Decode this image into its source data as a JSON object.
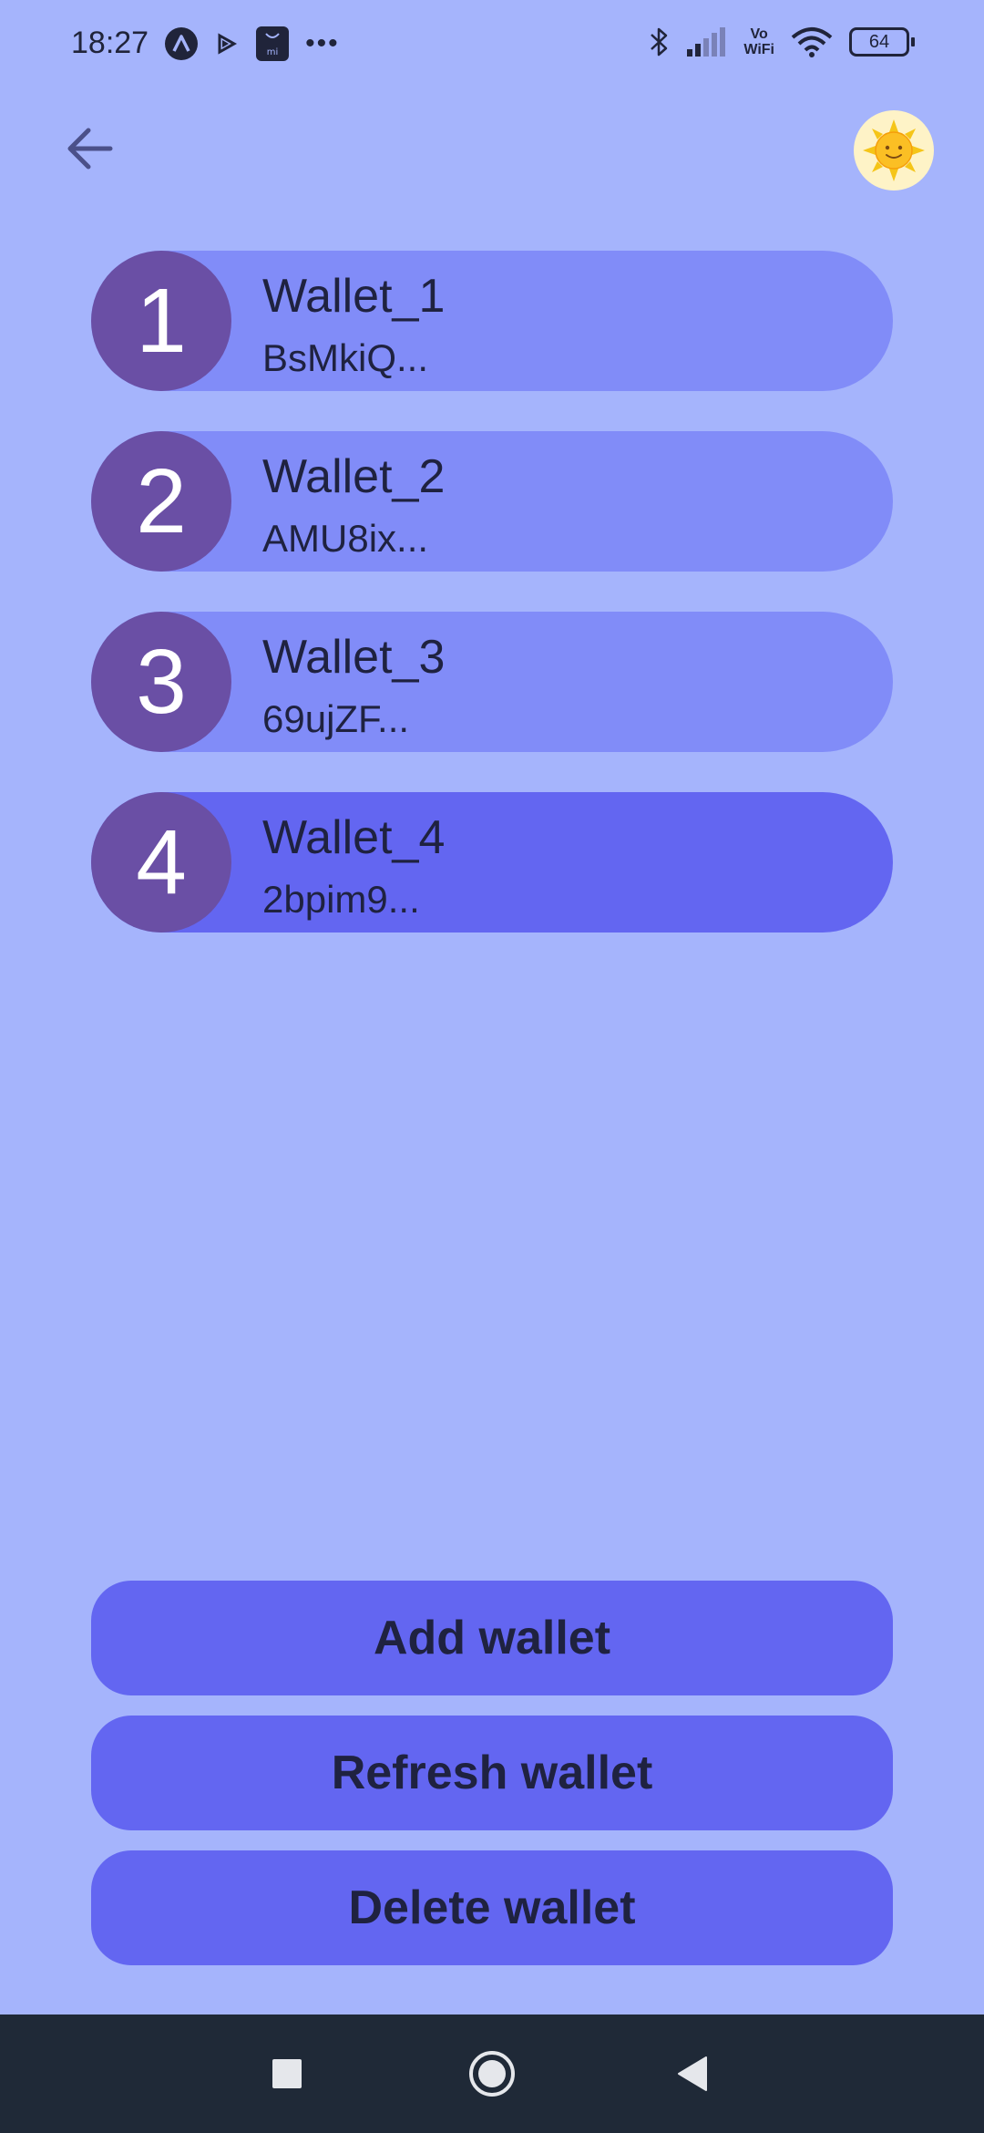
{
  "status_bar": {
    "time": "18:27",
    "more": "•••",
    "vowifi_top": "Vo",
    "vowifi_bottom": "WiFi",
    "battery": "64"
  },
  "header": {
    "back_icon": "arrow-left-icon",
    "theme_icon": "sun-icon"
  },
  "wallets": [
    {
      "number": "1",
      "name": "Wallet_1",
      "address": "BsMkiQ..."
    },
    {
      "number": "2",
      "name": "Wallet_2",
      "address": "AMU8ix..."
    },
    {
      "number": "3",
      "name": "Wallet_3",
      "address": "69ujZF..."
    },
    {
      "number": "4",
      "name": "Wallet_4",
      "address": "2bpim9..."
    }
  ],
  "actions": {
    "add": "Add wallet",
    "refresh": "Refresh wallet",
    "delete": "Delete wallet"
  },
  "colors": {
    "background": "#a5b4fc",
    "wallet_item": "#818cf8",
    "wallet_item_selected": "#6366f1",
    "badge": "#6a4fa5",
    "button": "#6366f1",
    "nav_bar": "#1f2937"
  },
  "nav_bar": {
    "recents_icon": "square-icon",
    "home_icon": "circle-icon",
    "back_icon": "triangle-back-icon"
  }
}
